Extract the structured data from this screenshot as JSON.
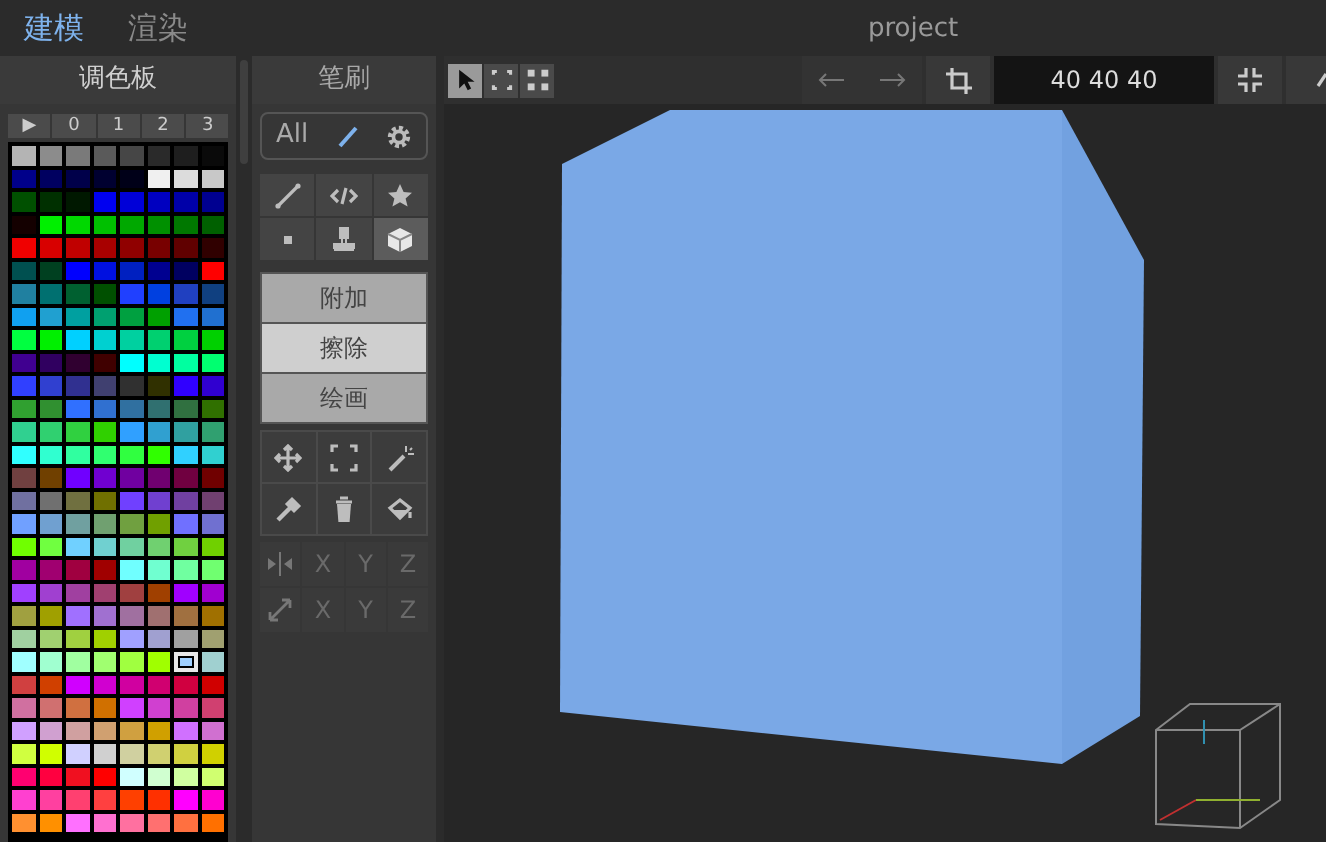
{
  "tabs": [
    {
      "label": "建模",
      "selected": true
    },
    {
      "label": "渲染",
      "selected": false
    }
  ],
  "window": {
    "title": "project"
  },
  "palette": {
    "title": "调色板",
    "pages": [
      "▶",
      "0",
      "1",
      "2",
      "3"
    ],
    "rows": [
      [
        {
          "color": "#b4b4b4",
          "selected": false
        },
        {
          "color": "#8c8c8c",
          "selected": false
        },
        {
          "color": "#7a7a7a",
          "selected": false
        },
        {
          "color": "#5a5a5a",
          "selected": false
        },
        {
          "color": "#464646",
          "selected": false
        },
        {
          "color": "#2a2a2a",
          "selected": false
        },
        {
          "color": "#1e1e1e",
          "selected": false
        },
        {
          "color": "#0a0a0a",
          "selected": false
        }
      ],
      [
        {
          "color": "#00008a",
          "selected": false
        },
        {
          "color": "#000060",
          "selected": false
        },
        {
          "color": "#00004a",
          "selected": false
        },
        {
          "color": "#000030",
          "selected": false
        },
        {
          "color": "#000018",
          "selected": false
        },
        {
          "color": "#f0f0f0",
          "selected": false
        },
        {
          "color": "#dcdcdc",
          "selected": false
        },
        {
          "color": "#c8c8c8",
          "selected": false
        }
      ],
      [
        {
          "color": "#005000",
          "selected": false
        },
        {
          "color": "#003000",
          "selected": false
        },
        {
          "color": "#001800",
          "selected": false
        },
        {
          "color": "#0000f0",
          "selected": false
        },
        {
          "color": "#0000d8",
          "selected": false
        },
        {
          "color": "#0000c0",
          "selected": false
        },
        {
          "color": "#0000a8",
          "selected": false
        },
        {
          "color": "#000090",
          "selected": false
        }
      ],
      [
        {
          "color": "#140000",
          "selected": false
        },
        {
          "color": "#00f000",
          "selected": false
        },
        {
          "color": "#00d800",
          "selected": false
        },
        {
          "color": "#00c000",
          "selected": false
        },
        {
          "color": "#00a800",
          "selected": false
        },
        {
          "color": "#009000",
          "selected": false
        },
        {
          "color": "#007800",
          "selected": false
        },
        {
          "color": "#006000",
          "selected": false
        }
      ],
      [
        {
          "color": "#f00000",
          "selected": false
        },
        {
          "color": "#d80000",
          "selected": false
        },
        {
          "color": "#c00000",
          "selected": false
        },
        {
          "color": "#a80000",
          "selected": false
        },
        {
          "color": "#900000",
          "selected": false
        },
        {
          "color": "#780000",
          "selected": false
        },
        {
          "color": "#600000",
          "selected": false
        },
        {
          "color": "#300000",
          "selected": false
        }
      ],
      [
        {
          "color": "#005050",
          "selected": false
        },
        {
          "color": "#004020",
          "selected": false
        },
        {
          "color": "#0000ff",
          "selected": false
        },
        {
          "color": "#0010e0",
          "selected": false
        },
        {
          "color": "#0020c0",
          "selected": false
        },
        {
          "color": "#000090",
          "selected": false
        },
        {
          "color": "#000060",
          "selected": false
        },
        {
          "color": "#ff0000",
          "selected": false
        }
      ],
      [
        {
          "color": "#2080a0",
          "selected": false
        },
        {
          "color": "#007070",
          "selected": false
        },
        {
          "color": "#006030",
          "selected": false
        },
        {
          "color": "#005000",
          "selected": false
        },
        {
          "color": "#2040ff",
          "selected": false
        },
        {
          "color": "#0040e0",
          "selected": false
        },
        {
          "color": "#2040c0",
          "selected": false
        },
        {
          "color": "#104080",
          "selected": false
        }
      ],
      [
        {
          "color": "#10a0f0",
          "selected": false
        },
        {
          "color": "#20a0d0",
          "selected": false
        },
        {
          "color": "#00a0a0",
          "selected": false
        },
        {
          "color": "#00a070",
          "selected": false
        },
        {
          "color": "#00a040",
          "selected": false
        },
        {
          "color": "#00a000",
          "selected": false
        },
        {
          "color": "#2070f0",
          "selected": false
        },
        {
          "color": "#2070d0",
          "selected": false
        }
      ],
      [
        {
          "color": "#00ff40",
          "selected": false
        },
        {
          "color": "#00f000",
          "selected": false
        },
        {
          "color": "#00d0ff",
          "selected": false
        },
        {
          "color": "#00d0d0",
          "selected": false
        },
        {
          "color": "#00d0a0",
          "selected": false
        },
        {
          "color": "#00d070",
          "selected": false
        },
        {
          "color": "#00d040",
          "selected": false
        },
        {
          "color": "#00d000",
          "selected": false
        }
      ],
      [
        {
          "color": "#400090",
          "selected": false
        },
        {
          "color": "#300060",
          "selected": false
        },
        {
          "color": "#300030",
          "selected": false
        },
        {
          "color": "#400000",
          "selected": false
        },
        {
          "color": "#00ffff",
          "selected": false
        },
        {
          "color": "#00ffd0",
          "selected": false
        },
        {
          "color": "#00ffa0",
          "selected": false
        },
        {
          "color": "#00ff70",
          "selected": false
        }
      ],
      [
        {
          "color": "#3040ff",
          "selected": false
        },
        {
          "color": "#3040d0",
          "selected": false
        },
        {
          "color": "#303090",
          "selected": false
        },
        {
          "color": "#404070",
          "selected": false
        },
        {
          "color": "#303030",
          "selected": false
        },
        {
          "color": "#303000",
          "selected": false
        },
        {
          "color": "#3000ff",
          "selected": false
        },
        {
          "color": "#3000d0",
          "selected": false
        }
      ],
      [
        {
          "color": "#30a030",
          "selected": false
        },
        {
          "color": "#309030",
          "selected": false
        },
        {
          "color": "#3070ff",
          "selected": false
        },
        {
          "color": "#3070d0",
          "selected": false
        },
        {
          "color": "#3070a0",
          "selected": false
        },
        {
          "color": "#307070",
          "selected": false
        },
        {
          "color": "#307040",
          "selected": false
        },
        {
          "color": "#307000",
          "selected": false
        }
      ],
      [
        {
          "color": "#30d090",
          "selected": false
        },
        {
          "color": "#30d070",
          "selected": false
        },
        {
          "color": "#30d040",
          "selected": false
        },
        {
          "color": "#30d000",
          "selected": false
        },
        {
          "color": "#30a0ff",
          "selected": false
        },
        {
          "color": "#30a0d0",
          "selected": false
        },
        {
          "color": "#30a0a0",
          "selected": false
        },
        {
          "color": "#30a070",
          "selected": false
        }
      ],
      [
        {
          "color": "#30ffff",
          "selected": false
        },
        {
          "color": "#30ffd0",
          "selected": false
        },
        {
          "color": "#30ffa0",
          "selected": false
        },
        {
          "color": "#30ff70",
          "selected": false
        },
        {
          "color": "#30ff40",
          "selected": false
        },
        {
          "color": "#30ff00",
          "selected": false
        },
        {
          "color": "#30d0ff",
          "selected": false
        },
        {
          "color": "#30d0d0",
          "selected": false
        }
      ],
      [
        {
          "color": "#704040",
          "selected": false
        },
        {
          "color": "#704000",
          "selected": false
        },
        {
          "color": "#7000ff",
          "selected": false
        },
        {
          "color": "#7000d0",
          "selected": false
        },
        {
          "color": "#7000a0",
          "selected": false
        },
        {
          "color": "#700070",
          "selected": false
        },
        {
          "color": "#700040",
          "selected": false
        },
        {
          "color": "#700000",
          "selected": false
        }
      ],
      [
        {
          "color": "#7070a0",
          "selected": false
        },
        {
          "color": "#707070",
          "selected": false
        },
        {
          "color": "#707040",
          "selected": false
        },
        {
          "color": "#707000",
          "selected": false
        },
        {
          "color": "#7040ff",
          "selected": false
        },
        {
          "color": "#7040d0",
          "selected": false
        },
        {
          "color": "#7040a0",
          "selected": false
        },
        {
          "color": "#704070",
          "selected": false
        }
      ],
      [
        {
          "color": "#70a0ff",
          "selected": false
        },
        {
          "color": "#70a0d0",
          "selected": false
        },
        {
          "color": "#70a0a0",
          "selected": false
        },
        {
          "color": "#70a070",
          "selected": false
        },
        {
          "color": "#70a040",
          "selected": false
        },
        {
          "color": "#70a000",
          "selected": false
        },
        {
          "color": "#7070ff",
          "selected": false
        },
        {
          "color": "#7070d0",
          "selected": false
        }
      ],
      [
        {
          "color": "#70ff00",
          "selected": false
        },
        {
          "color": "#70ff40",
          "selected": false
        },
        {
          "color": "#70d0ff",
          "selected": false
        },
        {
          "color": "#70d0d0",
          "selected": false
        },
        {
          "color": "#70d0a0",
          "selected": false
        },
        {
          "color": "#70d070",
          "selected": false
        },
        {
          "color": "#70d040",
          "selected": false
        },
        {
          "color": "#70d000",
          "selected": false
        }
      ],
      [
        {
          "color": "#a000a0",
          "selected": false
        },
        {
          "color": "#a00070",
          "selected": false
        },
        {
          "color": "#a00040",
          "selected": false
        },
        {
          "color": "#a00000",
          "selected": false
        },
        {
          "color": "#70ffff",
          "selected": false
        },
        {
          "color": "#70ffd0",
          "selected": false
        },
        {
          "color": "#70ffa0",
          "selected": false
        },
        {
          "color": "#70ff70",
          "selected": false
        }
      ],
      [
        {
          "color": "#a040ff",
          "selected": false
        },
        {
          "color": "#a040d0",
          "selected": false
        },
        {
          "color": "#a040a0",
          "selected": false
        },
        {
          "color": "#a04070",
          "selected": false
        },
        {
          "color": "#a04040",
          "selected": false
        },
        {
          "color": "#a04000",
          "selected": false
        },
        {
          "color": "#a000ff",
          "selected": false
        },
        {
          "color": "#a000d0",
          "selected": false
        }
      ],
      [
        {
          "color": "#a0a040",
          "selected": false
        },
        {
          "color": "#a0a000",
          "selected": false
        },
        {
          "color": "#a070ff",
          "selected": false
        },
        {
          "color": "#a070d0",
          "selected": false
        },
        {
          "color": "#a070a0",
          "selected": false
        },
        {
          "color": "#a07070",
          "selected": false
        },
        {
          "color": "#a07040",
          "selected": false
        },
        {
          "color": "#a07000",
          "selected": false
        }
      ],
      [
        {
          "color": "#a0d0a0",
          "selected": false
        },
        {
          "color": "#a0d070",
          "selected": false
        },
        {
          "color": "#a0d040",
          "selected": false
        },
        {
          "color": "#a0d000",
          "selected": false
        },
        {
          "color": "#a0a0ff",
          "selected": false
        },
        {
          "color": "#a0a0d0",
          "selected": false
        },
        {
          "color": "#a0a0a0",
          "selected": false
        },
        {
          "color": "#a0a070",
          "selected": false
        }
      ],
      [
        {
          "color": "#a0ffff",
          "selected": false
        },
        {
          "color": "#a0ffd0",
          "selected": false
        },
        {
          "color": "#a0ffa0",
          "selected": false
        },
        {
          "color": "#a0ff70",
          "selected": false
        },
        {
          "color": "#a0ff40",
          "selected": false
        },
        {
          "color": "#a0ff00",
          "selected": false
        },
        {
          "color": "#a0d0ff",
          "selected": true
        },
        {
          "color": "#a0d0d0",
          "selected": false
        }
      ],
      [
        {
          "color": "#d04040",
          "selected": false
        },
        {
          "color": "#d04000",
          "selected": false
        },
        {
          "color": "#d000ff",
          "selected": false
        },
        {
          "color": "#d000d0",
          "selected": false
        },
        {
          "color": "#d000a0",
          "selected": false
        },
        {
          "color": "#d00070",
          "selected": false
        },
        {
          "color": "#d00040",
          "selected": false
        },
        {
          "color": "#d00000",
          "selected": false
        }
      ],
      [
        {
          "color": "#d070a0",
          "selected": false
        },
        {
          "color": "#d07070",
          "selected": false
        },
        {
          "color": "#d07040",
          "selected": false
        },
        {
          "color": "#d07000",
          "selected": false
        },
        {
          "color": "#d040ff",
          "selected": false
        },
        {
          "color": "#d040d0",
          "selected": false
        },
        {
          "color": "#d040a0",
          "selected": false
        },
        {
          "color": "#d04070",
          "selected": false
        }
      ],
      [
        {
          "color": "#d0a0ff",
          "selected": false
        },
        {
          "color": "#d0a0d0",
          "selected": false
        },
        {
          "color": "#d0a0a0",
          "selected": false
        },
        {
          "color": "#d0a070",
          "selected": false
        },
        {
          "color": "#d0a040",
          "selected": false
        },
        {
          "color": "#d0a000",
          "selected": false
        },
        {
          "color": "#d070ff",
          "selected": false
        },
        {
          "color": "#d070d0",
          "selected": false
        }
      ],
      [
        {
          "color": "#d0ff40",
          "selected": false
        },
        {
          "color": "#d0ff00",
          "selected": false
        },
        {
          "color": "#d0d0ff",
          "selected": false
        },
        {
          "color": "#d0d0d0",
          "selected": false
        },
        {
          "color": "#d0d0a0",
          "selected": false
        },
        {
          "color": "#d0d070",
          "selected": false
        },
        {
          "color": "#d0d040",
          "selected": false
        },
        {
          "color": "#d0d000",
          "selected": false
        }
      ],
      [
        {
          "color": "#ff0070",
          "selected": false
        },
        {
          "color": "#ff0040",
          "selected": false
        },
        {
          "color": "#f01020",
          "selected": false
        },
        {
          "color": "#ff0000",
          "selected": false
        },
        {
          "color": "#d0ffff",
          "selected": false
        },
        {
          "color": "#d0ffd0",
          "selected": false
        },
        {
          "color": "#d0ffa0",
          "selected": false
        },
        {
          "color": "#d0ff70",
          "selected": false
        }
      ],
      [
        {
          "color": "#ff40d0",
          "selected": false
        },
        {
          "color": "#ff40a0",
          "selected": false
        },
        {
          "color": "#ff4070",
          "selected": false
        },
        {
          "color": "#ff4040",
          "selected": false
        },
        {
          "color": "#ff4000",
          "selected": false
        },
        {
          "color": "#ff3000",
          "selected": false
        },
        {
          "color": "#ff00ff",
          "selected": false
        },
        {
          "color": "#ff00d0",
          "selected": false
        }
      ],
      [
        {
          "color": "#ff9030",
          "selected": false
        },
        {
          "color": "#ff9000",
          "selected": false
        },
        {
          "color": "#ff70ff",
          "selected": false
        },
        {
          "color": "#ff70d0",
          "selected": false
        },
        {
          "color": "#ff70a0",
          "selected": false
        },
        {
          "color": "#ff7070",
          "selected": false
        },
        {
          "color": "#ff7040",
          "selected": false
        },
        {
          "color": "#ff7000",
          "selected": false
        }
      ]
    ]
  },
  "brush": {
    "title": "笔刷",
    "filter": "All",
    "shapes": [
      {
        "kind": "line",
        "selected": false
      },
      {
        "kind": "code",
        "selected": false
      },
      {
        "kind": "star",
        "selected": false
      },
      {
        "kind": "dot",
        "selected": false
      },
      {
        "kind": "stamp",
        "selected": false
      },
      {
        "kind": "cube",
        "selected": true
      }
    ],
    "modes": [
      {
        "label": "附加",
        "selected": false
      },
      {
        "label": "擦除",
        "selected": true
      },
      {
        "label": "绘画",
        "selected": false
      }
    ],
    "tools": [
      {
        "kind": "move"
      },
      {
        "kind": "frame"
      },
      {
        "kind": "wand"
      },
      {
        "kind": "picker"
      },
      {
        "kind": "trash"
      },
      {
        "kind": "bucket"
      }
    ],
    "axes": [
      {
        "kind": "mirror",
        "labels": [
          "X",
          "Y",
          "Z"
        ]
      },
      {
        "kind": "scale",
        "labels": [
          "X",
          "Y",
          "Z"
        ]
      }
    ]
  },
  "toolbar": {
    "select_modes": [
      {
        "kind": "cursor",
        "selected": true
      },
      {
        "kind": "box",
        "selected": false
      },
      {
        "kind": "points",
        "selected": false
      }
    ],
    "size": "40 40 40"
  }
}
